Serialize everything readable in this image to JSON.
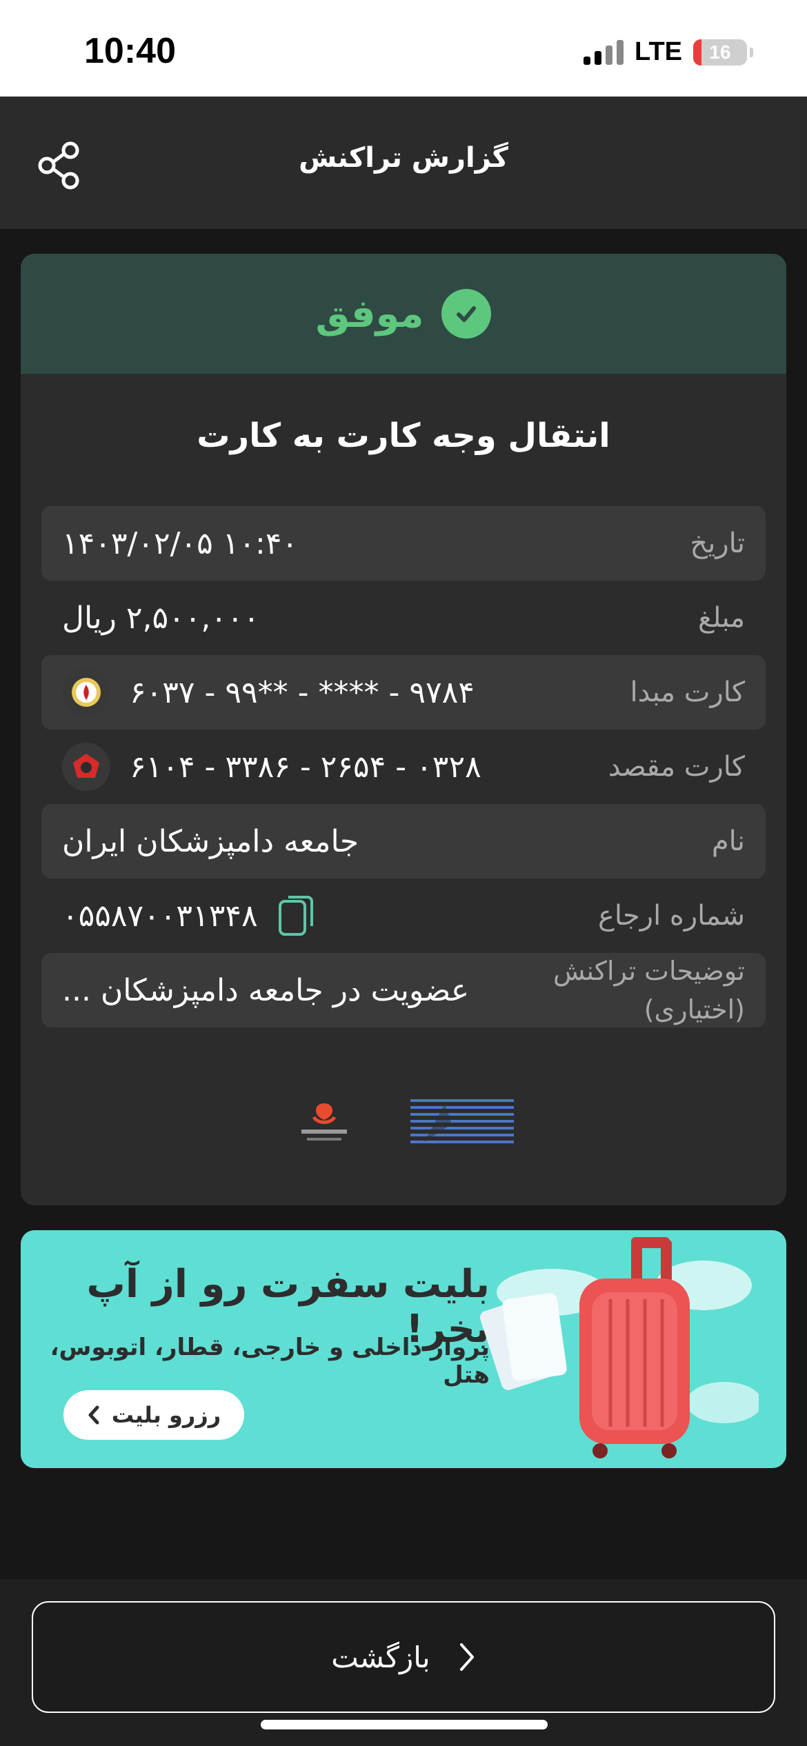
{
  "status_bar": {
    "time": "10:40",
    "network": "LTE",
    "battery": "16",
    "battery_level": 0.16
  },
  "header": {
    "title": "گزارش تراکنش",
    "share_icon": "share-icon"
  },
  "receipt": {
    "status": "موفق",
    "status_color": "#5ec77e",
    "title": "انتقال وجه کارت به کارت",
    "rows": [
      {
        "label": "تاریخ",
        "value": "۱۴۰۳/۰۲/۰۵ ۱۰:۴۰"
      },
      {
        "label": "مبلغ",
        "value": "۲,۵۰۰,۰۰۰ ریال"
      },
      {
        "label": "کارت مبدا",
        "value": "۹۷۸۴ - **** - **۹۹ - ۶۰۳۷"
      },
      {
        "label": "کارت مقصد",
        "value": "۰۳۲۸ - ۲۶۵۴ - ۳۳۸۶ - ۶۱۰۴"
      },
      {
        "label": "نام",
        "value": "جامعه دامپزشکان ایران"
      },
      {
        "label": "شماره ارجاع",
        "value": "۰۵۵۸۷۰۰۳۱۳۴۸"
      },
      {
        "label": "توضیحات تراکنش (اختیاری)",
        "value": "عضویت در جامعه دامپزشکان ..."
      }
    ]
  },
  "banner": {
    "title": "بلیت سفرت رو از آپ بخر!",
    "subtitle": "پرواز داخلی و خارجی، قطار، اتوبوس، هتل",
    "button": "رزرو بلیت"
  },
  "footer": {
    "back_button": "بازگشت"
  }
}
